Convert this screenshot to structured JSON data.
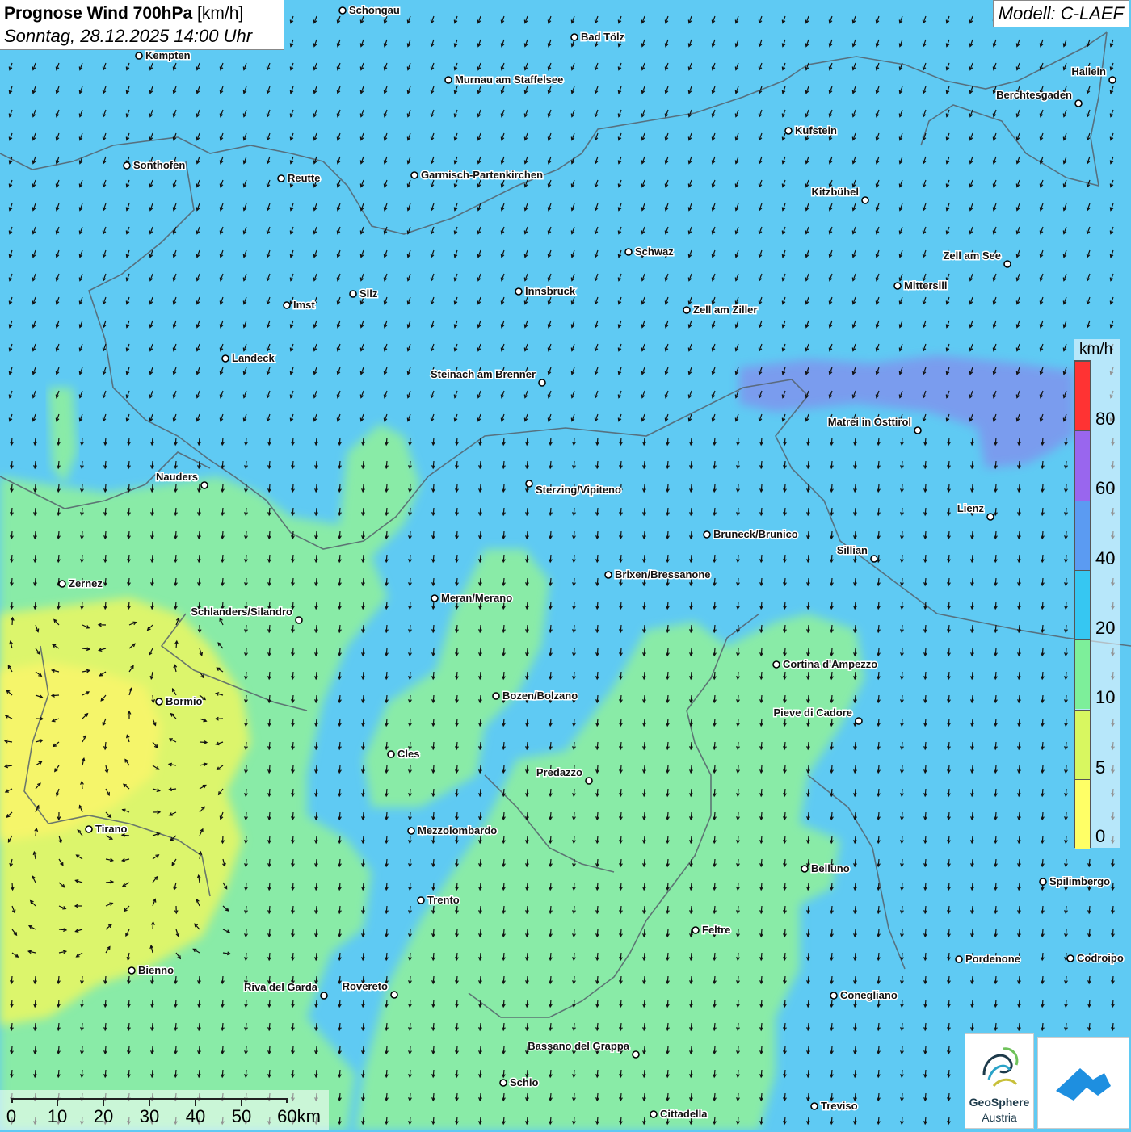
{
  "title": {
    "main_bold": "Prognose Wind 700hPa",
    "unit": "[km/h]",
    "datetime": "Sonntag, 28.12.2025 14:00 Uhr"
  },
  "model": "Modell: C-LAEF",
  "legend": {
    "unit": "km/h",
    "labels": [
      "80",
      "60",
      "40",
      "20",
      "10",
      "5",
      "0"
    ],
    "colors": [
      "#ff3333",
      "#9966ee",
      "#5b9bf2",
      "#36c7f2",
      "#7def9a",
      "#d8f760",
      "#ffff66"
    ]
  },
  "scale": {
    "labels": [
      "0",
      "10",
      "20",
      "30",
      "40",
      "50",
      "60km"
    ]
  },
  "logos": {
    "geosphere_name": "GeoSphere",
    "geosphere_sub": "Austria"
  },
  "cities": [
    {
      "name": "Schongau"
    },
    {
      "name": "Kempten"
    },
    {
      "name": "Bad Tölz"
    },
    {
      "name": "Murnau am Staffelsee"
    },
    {
      "name": "Hallein"
    },
    {
      "name": "Berchtesgaden"
    },
    {
      "name": "Kufstein"
    },
    {
      "name": "Sonthofen"
    },
    {
      "name": "Reutte"
    },
    {
      "name": "Garmisch-Partenkirchen"
    },
    {
      "name": "Kitzbühel"
    },
    {
      "name": "Schwaz"
    },
    {
      "name": "Zell am See"
    },
    {
      "name": "Mittersill"
    },
    {
      "name": "Innsbruck"
    },
    {
      "name": "Zell am Ziller"
    },
    {
      "name": "Silz"
    },
    {
      "name": "Imst"
    },
    {
      "name": "Landeck"
    },
    {
      "name": "Steinach am Brenner"
    },
    {
      "name": "Matrei in Osttirol"
    },
    {
      "name": "Nauders"
    },
    {
      "name": "Sterzing/Vipiteno"
    },
    {
      "name": "Lienz"
    },
    {
      "name": "Bruneck/Brunico"
    },
    {
      "name": "Sillian"
    },
    {
      "name": "Brixen/Bressanone"
    },
    {
      "name": "Zernez"
    },
    {
      "name": "Meran/Merano"
    },
    {
      "name": "Schlanders/Silandro"
    },
    {
      "name": "Cortina d'Ampezzo"
    },
    {
      "name": "Bozen/Bolzano"
    },
    {
      "name": "Bormio"
    },
    {
      "name": "Pieve di Cadore"
    },
    {
      "name": "Cles"
    },
    {
      "name": "Predazzo"
    },
    {
      "name": "Tirano"
    },
    {
      "name": "Mezzolombardo"
    },
    {
      "name": "Belluno"
    },
    {
      "name": "Spilimbergo"
    },
    {
      "name": "Trento"
    },
    {
      "name": "Feltre"
    },
    {
      "name": "Pordenone"
    },
    {
      "name": "Codroipo"
    },
    {
      "name": "Bienno"
    },
    {
      "name": "Riva del Garda"
    },
    {
      "name": "Rovereto"
    },
    {
      "name": "Conegliano"
    },
    {
      "name": "Bassano del Grappa"
    },
    {
      "name": "Schio"
    },
    {
      "name": "Treviso"
    },
    {
      "name": "Cittadella"
    }
  ]
}
